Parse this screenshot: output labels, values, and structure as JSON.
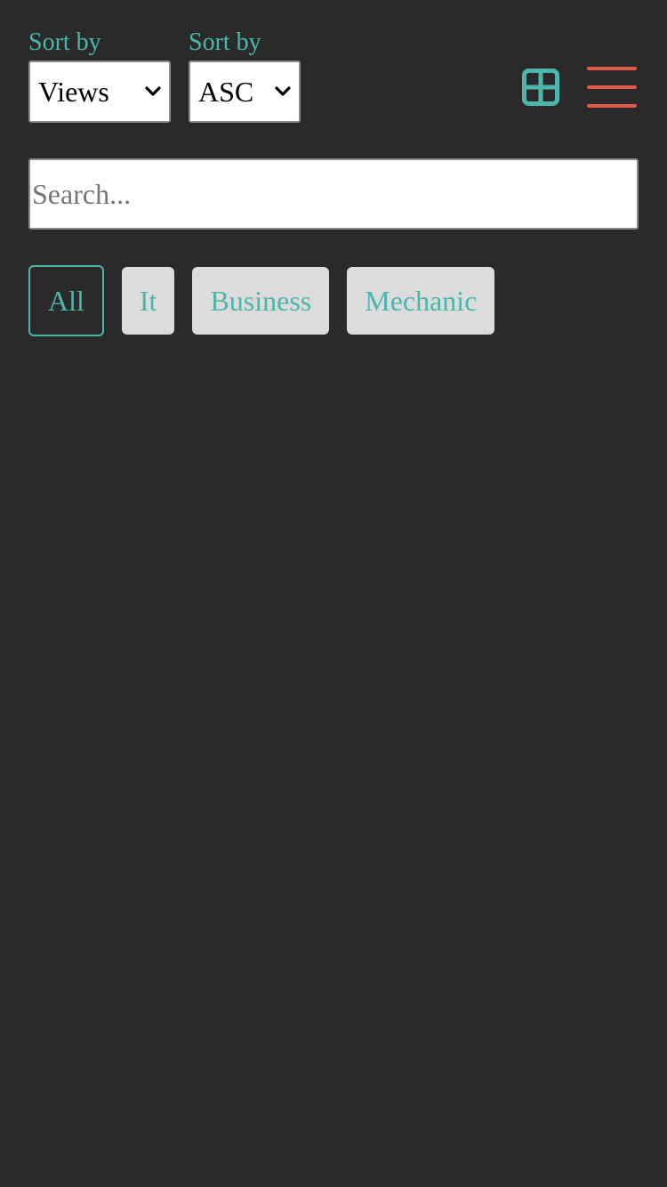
{
  "sort_by": {
    "label": "Sort by",
    "field_value": "Views",
    "order_value": "ASC"
  },
  "view_toggle": {
    "grid_icon": "grid-view-icon",
    "list_icon": "menu-list-icon",
    "grid_color": "#4db6ac",
    "list_color": "#e0594b"
  },
  "search": {
    "placeholder": "Search...",
    "value": ""
  },
  "filters": {
    "items": [
      {
        "label": "All",
        "active": true
      },
      {
        "label": "It",
        "active": false
      },
      {
        "label": "Business",
        "active": false
      },
      {
        "label": "Mechanic",
        "active": false
      }
    ]
  },
  "colors": {
    "background": "#2a2a2a",
    "accent": "#4db6ac",
    "chip_inactive_bg": "#dcdcdc"
  }
}
